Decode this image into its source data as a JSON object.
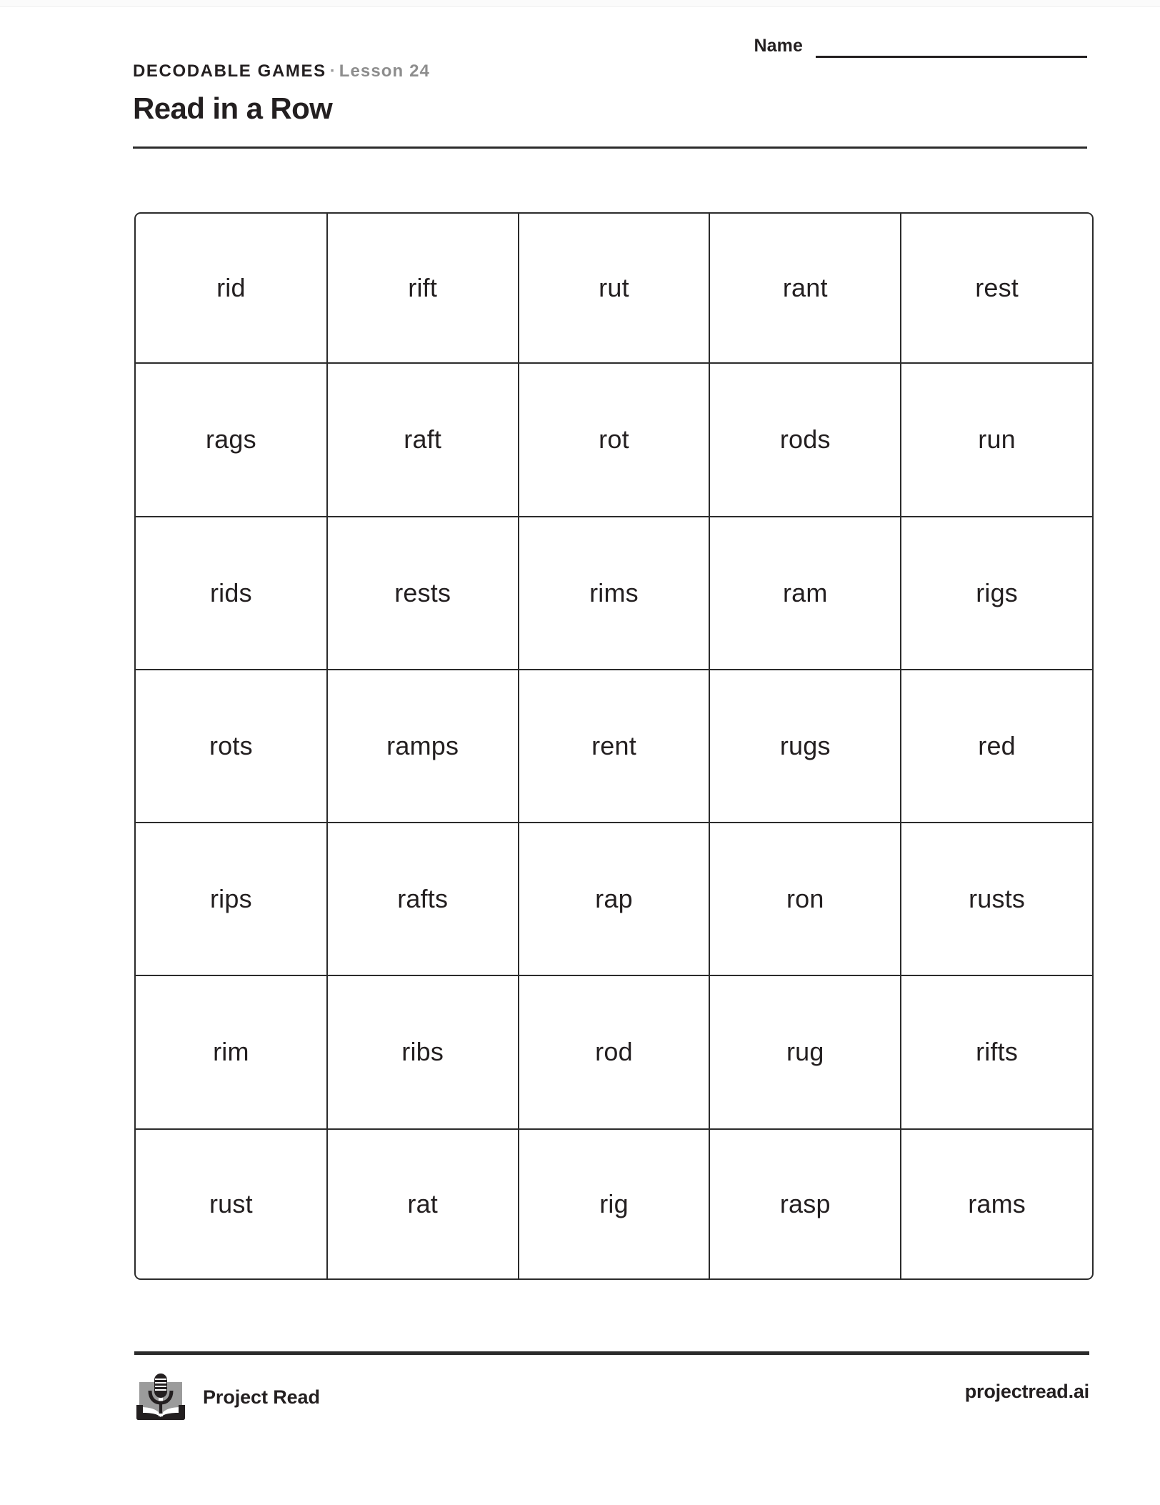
{
  "header": {
    "kicker": "DECODABLE GAMES",
    "separator": "·",
    "lesson": "Lesson 24",
    "title": "Read in a Row",
    "name_label": "Name",
    "name_value": ""
  },
  "grid": {
    "rows": 7,
    "columns": 5,
    "words": [
      [
        "rid",
        "rift",
        "rut",
        "rant",
        "rest"
      ],
      [
        "rags",
        "raft",
        "rot",
        "rods",
        "run"
      ],
      [
        "rids",
        "rests",
        "rims",
        "ram",
        "rigs"
      ],
      [
        "rots",
        "ramps",
        "rent",
        "rugs",
        "red"
      ],
      [
        "rips",
        "rafts",
        "rap",
        "ron",
        "rusts"
      ],
      [
        "rim",
        "ribs",
        "rod",
        "rug",
        "rifts"
      ],
      [
        "rust",
        "rat",
        "rig",
        "rasp",
        "rams"
      ]
    ]
  },
  "footer": {
    "brand_name": "Project Read",
    "logo_icon": "book-microphone-icon",
    "site_url": "projectread.ai"
  },
  "colors": {
    "ink": "#231f20",
    "rule": "#2b2b2b",
    "muted": "#8d8d8d",
    "logo_page": "#9b9b9b",
    "logo_dark": "#231f20",
    "paper": "#ffffff"
  }
}
